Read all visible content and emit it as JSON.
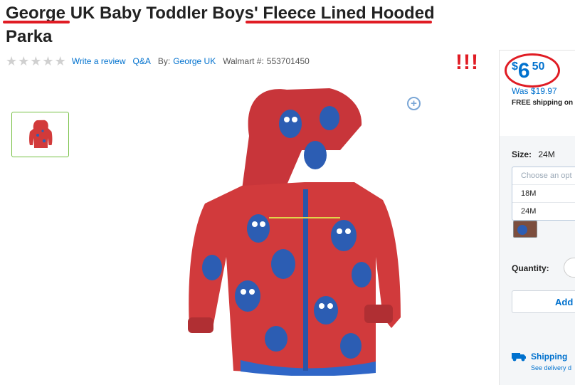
{
  "product": {
    "title": "George UK Baby Toddler Boys' Fleece Lined Hooded Parka",
    "stars": [
      "★",
      "★",
      "★",
      "★",
      "★"
    ],
    "write_review": "Write a review",
    "qa": "Q&A",
    "by_label": "By:",
    "brand": "George UK",
    "walmart_label": "Walmart #:",
    "walmart_number": "553701450"
  },
  "annotation": {
    "exclaim": "!!!",
    "color": "#e01c24"
  },
  "buybox": {
    "currency": "$",
    "price_whole": "6",
    "price_cents": "50",
    "was": "Was $19.97",
    "shipping_note": "FREE shipping on o",
    "size_label": "Size:",
    "size_value": "24M",
    "size_placeholder": "Choose an opt",
    "size_options": [
      "18M",
      "24M"
    ],
    "quantity_label": "Quantity:",
    "add_label": "Add t",
    "ship_title": "Shipping",
    "ship_sub": "See delivery d"
  },
  "colors": {
    "accent": "#0071ce",
    "highlight": "#e01c24",
    "thumb_border": "#76c043"
  }
}
